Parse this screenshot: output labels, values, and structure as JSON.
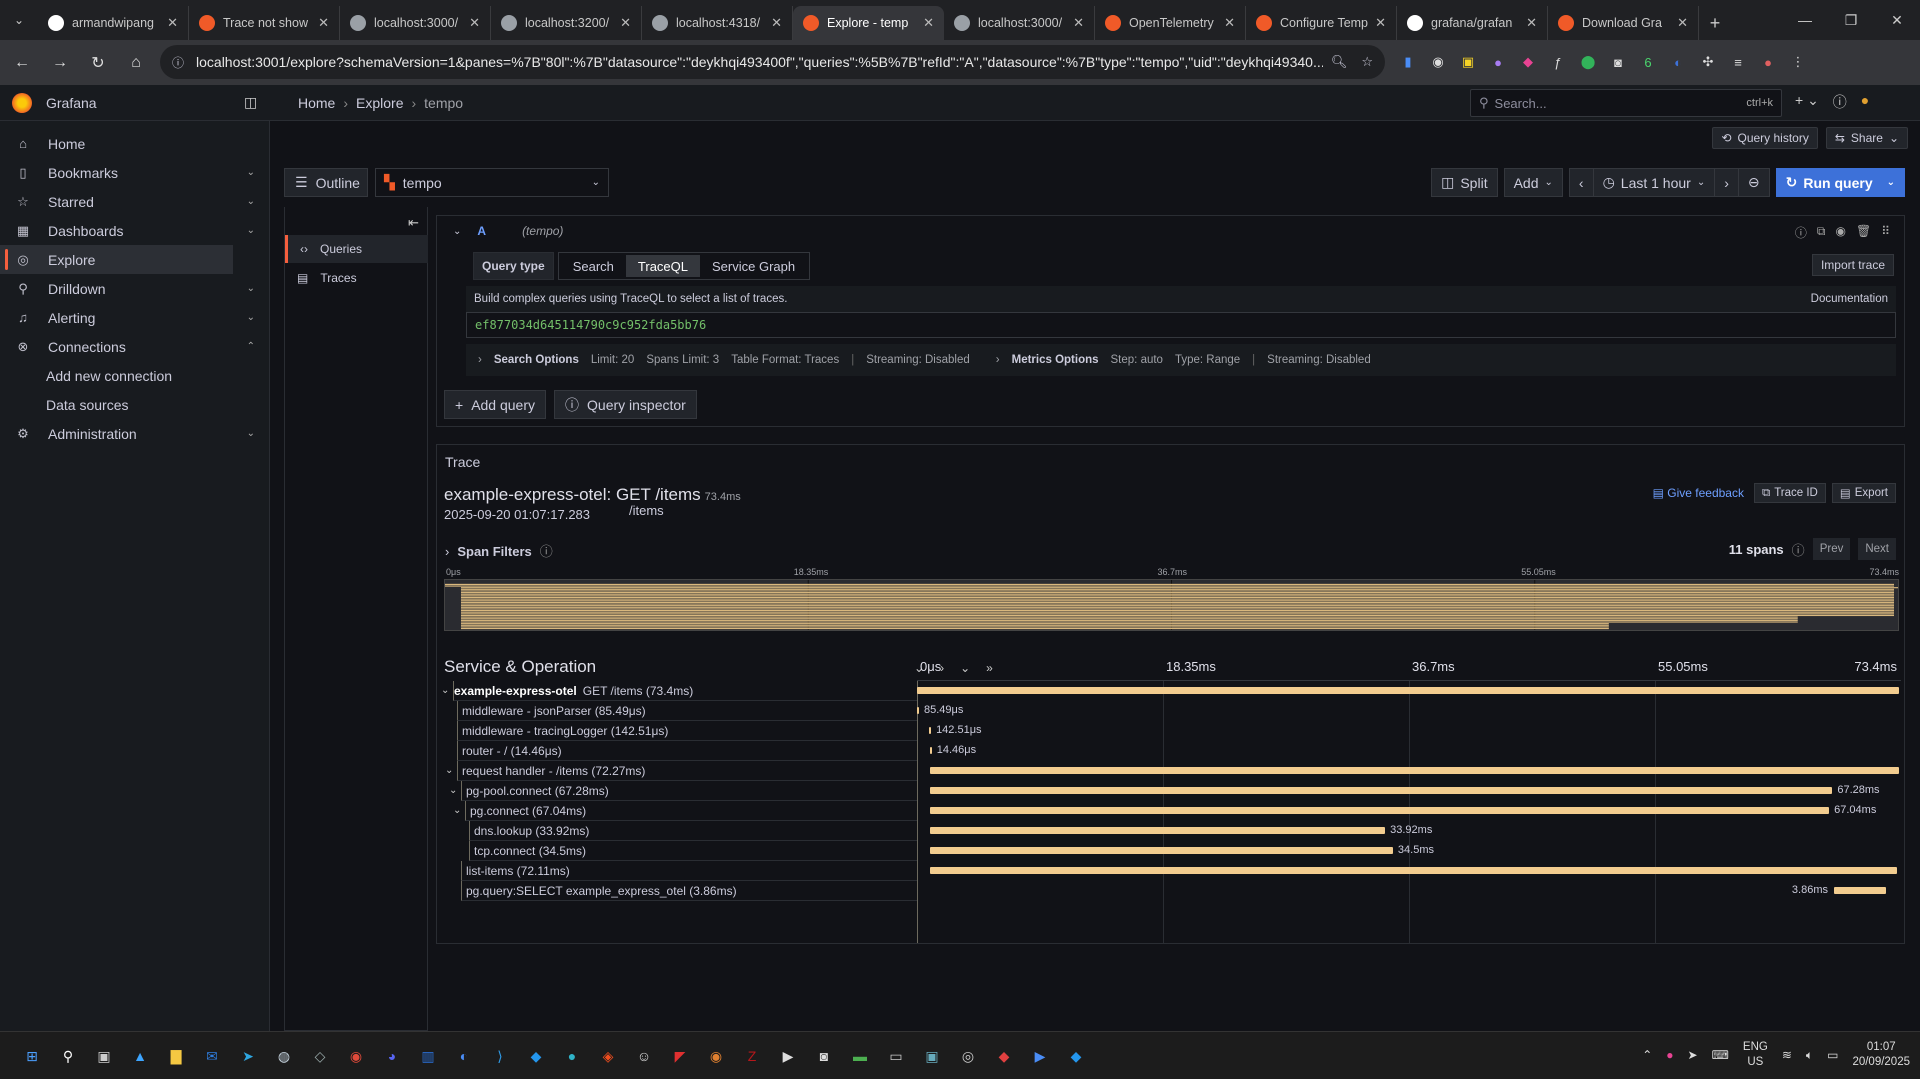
{
  "browser": {
    "tabs": [
      {
        "title": "armandwipang",
        "color": "#ffffff"
      },
      {
        "title": "Trace not show",
        "color": "#f05a28"
      },
      {
        "title": "localhost:3000/",
        "color": "#9aa0a6"
      },
      {
        "title": "localhost:3200/",
        "color": "#9aa0a6"
      },
      {
        "title": "localhost:4318/",
        "color": "#9aa0a6"
      },
      {
        "title": "Explore - temp",
        "color": "#f05a28",
        "active": true
      },
      {
        "title": "localhost:3000/",
        "color": "#9aa0a6"
      },
      {
        "title": "OpenTelemetry",
        "color": "#f05a28"
      },
      {
        "title": "Configure Temp",
        "color": "#f05a28"
      },
      {
        "title": "grafana/grafan",
        "color": "#ffffff"
      },
      {
        "title": "Download Gra",
        "color": "#f05a28"
      }
    ],
    "url": "localhost:3001/explore?schemaVersion=1&panes=%7B\"80l\":%7B\"datasource\":\"deykhqi493400f\",\"queries\":%5B%7B\"refId\":\"A\",\"datasource\":%7B\"type\":\"tempo\",\"uid\":\"deykhqi49340..."
  },
  "grafana": {
    "app_name": "Grafana",
    "breadcrumb": [
      "Home",
      "Explore",
      "tempo"
    ],
    "search_placeholder": "Search...",
    "search_shortcut": "ctrl+k",
    "accent": "#f55f3e",
    "nav": [
      {
        "label": "Home",
        "icon": "home-icon",
        "glyph": "⌂"
      },
      {
        "label": "Bookmarks",
        "icon": "bookmark-icon",
        "glyph": "▯",
        "chev": "⌄"
      },
      {
        "label": "Starred",
        "icon": "star-icon",
        "glyph": "☆",
        "chev": "⌄"
      },
      {
        "label": "Dashboards",
        "icon": "dashboards-icon",
        "glyph": "▦",
        "chev": "⌄"
      },
      {
        "label": "Explore",
        "icon": "compass-icon",
        "glyph": "◎",
        "active": true
      },
      {
        "label": "Drilldown",
        "icon": "drilldown-icon",
        "glyph": "⚲",
        "chev": "⌄"
      },
      {
        "label": "Alerting",
        "icon": "bell-icon",
        "glyph": "♫",
        "chev": "⌄"
      },
      {
        "label": "Connections",
        "icon": "connections-icon",
        "glyph": "⊗",
        "chev": "⌃"
      },
      {
        "label": "Add new connection",
        "sub": true
      },
      {
        "label": "Data sources",
        "sub": true
      },
      {
        "label": "Administration",
        "icon": "gear-icon",
        "glyph": "⚙",
        "chev": "⌄"
      }
    ],
    "toolbar": {
      "query_history": "Query history",
      "share": "Share"
    }
  },
  "explore": {
    "outline": "Outline",
    "datasource": "tempo",
    "split": "Split",
    "add": "Add",
    "time_range": "Last 1 hour",
    "run_query": "Run query",
    "outline_items": [
      "Queries",
      "Traces"
    ],
    "query": {
      "ref": "A",
      "ds": "(tempo)",
      "type_label": "Query type",
      "types": [
        "Search",
        "TraceQL",
        "Service Graph"
      ],
      "selected_type": "TraceQL",
      "import_trace": "Import trace",
      "info": "Build complex queries using TraceQL to select a list of traces.",
      "documentation": "Documentation",
      "traceql": "ef877034d645114790c9c952fda5bb76",
      "search_options": {
        "title": "Search Options",
        "limit": "Limit: 20",
        "spans_limit": "Spans Limit: 3",
        "table_format": "Table Format: Traces",
        "streaming": "Streaming: Disabled"
      },
      "metrics_options": {
        "title": "Metrics Options",
        "step": "Step: auto",
        "type": "Type: Range",
        "streaming": "Streaming: Disabled"
      }
    },
    "add_query": "Add query",
    "query_inspector": "Query inspector"
  },
  "trace": {
    "panel_title": "Trace",
    "name": "example-express-otel: GET /items",
    "duration": "73.4ms",
    "timestamp": "2025-09-20 01:07:17.283",
    "url": "/items",
    "give_feedback": "Give feedback",
    "trace_id_btn": "Trace ID",
    "export_btn": "Export",
    "span_filters": "Span Filters",
    "span_count": "11 spans",
    "prev": "Prev",
    "next": "Next",
    "minimap_ticks": [
      "0μs",
      "18.35ms",
      "36.7ms",
      "55.05ms",
      "73.4ms"
    ],
    "header": "Service & Operation",
    "ticks": [
      "0μs",
      "18.35ms",
      "36.7ms",
      "55.05ms",
      "73.4ms"
    ],
    "total_ms": 73.4,
    "spans": [
      {
        "service": "example-express-otel",
        "op": "GET /items (73.4ms)",
        "start": 0,
        "dur": 73.4,
        "depth": 0,
        "toggle": "⌄",
        "label": ""
      },
      {
        "op": "middleware - jsonParser (85.49μs)",
        "start": 0.0,
        "dur": 0.08549,
        "depth": 1,
        "label": "85.49μs"
      },
      {
        "op": "middleware - tracingLogger (142.51μs)",
        "start": 0.9,
        "dur": 0.14251,
        "depth": 1,
        "label": "142.51μs"
      },
      {
        "op": "router - / (14.46μs)",
        "start": 0.95,
        "dur": 0.01446,
        "depth": 1,
        "label": "14.46μs"
      },
      {
        "op": "request handler - /items (72.27ms)",
        "start": 1.0,
        "dur": 72.27,
        "depth": 1,
        "toggle": "⌄",
        "label": ""
      },
      {
        "op": "pg-pool.connect (67.28ms)",
        "start": 1.0,
        "dur": 67.28,
        "depth": 2,
        "toggle": "⌄",
        "label": "67.28ms"
      },
      {
        "op": "pg.connect (67.04ms)",
        "start": 1.0,
        "dur": 67.04,
        "depth": 3,
        "toggle": "⌄",
        "label": "67.04ms"
      },
      {
        "op": "dns.lookup (33.92ms)",
        "start": 1.0,
        "dur": 33.92,
        "depth": 4,
        "label": "33.92ms"
      },
      {
        "op": "tcp.connect (34.5ms)",
        "start": 1.0,
        "dur": 34.5,
        "depth": 4,
        "label": "34.5ms"
      },
      {
        "op": "list-items (72.11ms)",
        "start": 1.0,
        "dur": 72.11,
        "depth": 2,
        "label": ""
      },
      {
        "op": "pg.query:SELECT example_express_otel (3.86ms)",
        "start": 68.4,
        "dur": 3.86,
        "depth": 2,
        "label": "3.86ms",
        "label_left": true
      }
    ]
  },
  "taskbar": {
    "lang": "ENG",
    "region": "US",
    "time": "01:07",
    "date": "20/09/2025"
  }
}
